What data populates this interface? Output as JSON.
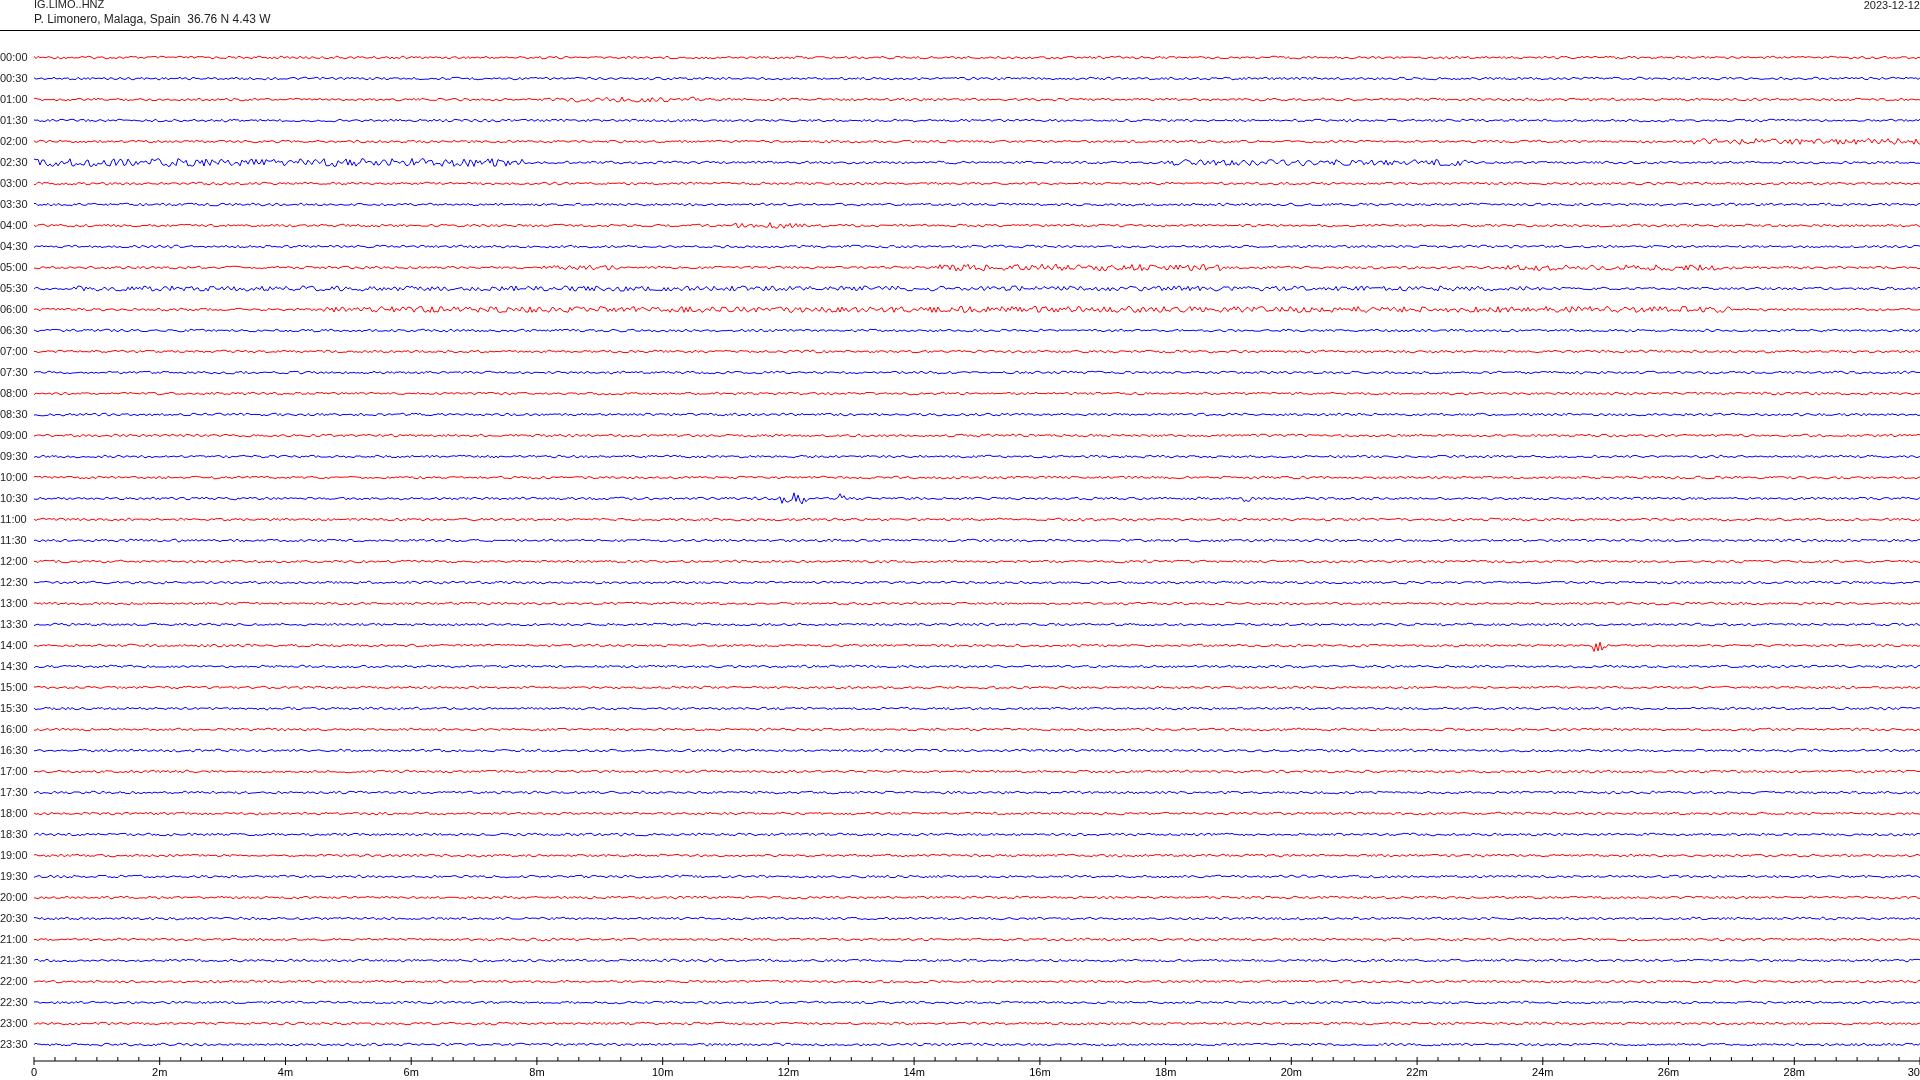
{
  "header": {
    "station": "IG.LIMO..HNZ",
    "location": "P. Limonero, Malaga, Spain  36.76 N 4.43 W",
    "date": "2023-12-12"
  },
  "rows": [
    {
      "time": "00:00",
      "color": "#ff0000"
    },
    {
      "time": "00:30",
      "color": "#0000ff"
    },
    {
      "time": "01:00",
      "color": "#ff0000"
    },
    {
      "time": "01:30",
      "color": "#0000ff"
    },
    {
      "time": "02:00",
      "color": "#ff0000"
    },
    {
      "time": "02:30",
      "color": "#0000ff"
    },
    {
      "time": "03:00",
      "color": "#ff0000"
    },
    {
      "time": "03:30",
      "color": "#0000ff"
    },
    {
      "time": "04:00",
      "color": "#ff0000"
    },
    {
      "time": "04:30",
      "color": "#0000ff"
    },
    {
      "time": "05:00",
      "color": "#ff0000"
    },
    {
      "time": "05:30",
      "color": "#0000ff"
    },
    {
      "time": "06:00",
      "color": "#ff0000"
    },
    {
      "time": "06:30",
      "color": "#0000ff"
    },
    {
      "time": "07:00",
      "color": "#ff0000"
    },
    {
      "time": "07:30",
      "color": "#0000ff"
    },
    {
      "time": "08:00",
      "color": "#ff0000"
    },
    {
      "time": "08:30",
      "color": "#0000ff"
    },
    {
      "time": "09:00",
      "color": "#ff0000"
    },
    {
      "time": "09:30",
      "color": "#0000ff"
    },
    {
      "time": "10:00",
      "color": "#ff0000"
    },
    {
      "time": "10:30",
      "color": "#0000ff"
    },
    {
      "time": "11:00",
      "color": "#ff0000"
    },
    {
      "time": "11:30",
      "color": "#0000ff"
    },
    {
      "time": "12:00",
      "color": "#ff0000"
    },
    {
      "time": "12:30",
      "color": "#0000ff"
    },
    {
      "time": "13:00",
      "color": "#ff0000"
    },
    {
      "time": "13:30",
      "color": "#0000ff"
    },
    {
      "time": "14:00",
      "color": "#ff0000"
    },
    {
      "time": "14:30",
      "color": "#0000ff"
    },
    {
      "time": "15:00",
      "color": "#ff0000"
    },
    {
      "time": "15:30",
      "color": "#0000ff"
    },
    {
      "time": "16:00",
      "color": "#ff0000"
    },
    {
      "time": "16:30",
      "color": "#0000ff"
    },
    {
      "time": "17:00",
      "color": "#ff0000"
    },
    {
      "time": "17:30",
      "color": "#0000ff"
    },
    {
      "time": "18:00",
      "color": "#ff0000"
    },
    {
      "time": "18:30",
      "color": "#0000ff"
    },
    {
      "time": "19:00",
      "color": "#ff0000"
    },
    {
      "time": "19:30",
      "color": "#0000ff"
    },
    {
      "time": "20:00",
      "color": "#ff0000"
    },
    {
      "time": "20:30",
      "color": "#0000ff"
    },
    {
      "time": "21:00",
      "color": "#ff0000"
    },
    {
      "time": "21:30",
      "color": "#0000ff"
    },
    {
      "time": "22:00",
      "color": "#ff0000"
    },
    {
      "time": "22:30",
      "color": "#0000ff"
    },
    {
      "time": "23:00",
      "color": "#ff0000"
    },
    {
      "time": "23:30",
      "color": "#0000ff"
    }
  ],
  "time_axis": {
    "labels": [
      "0",
      "2m",
      "4m",
      "6m",
      "8m",
      "10m",
      "12m",
      "14m",
      "16m",
      "18m",
      "20m",
      "22m",
      "24m",
      "26m",
      "28m",
      "30"
    ]
  }
}
